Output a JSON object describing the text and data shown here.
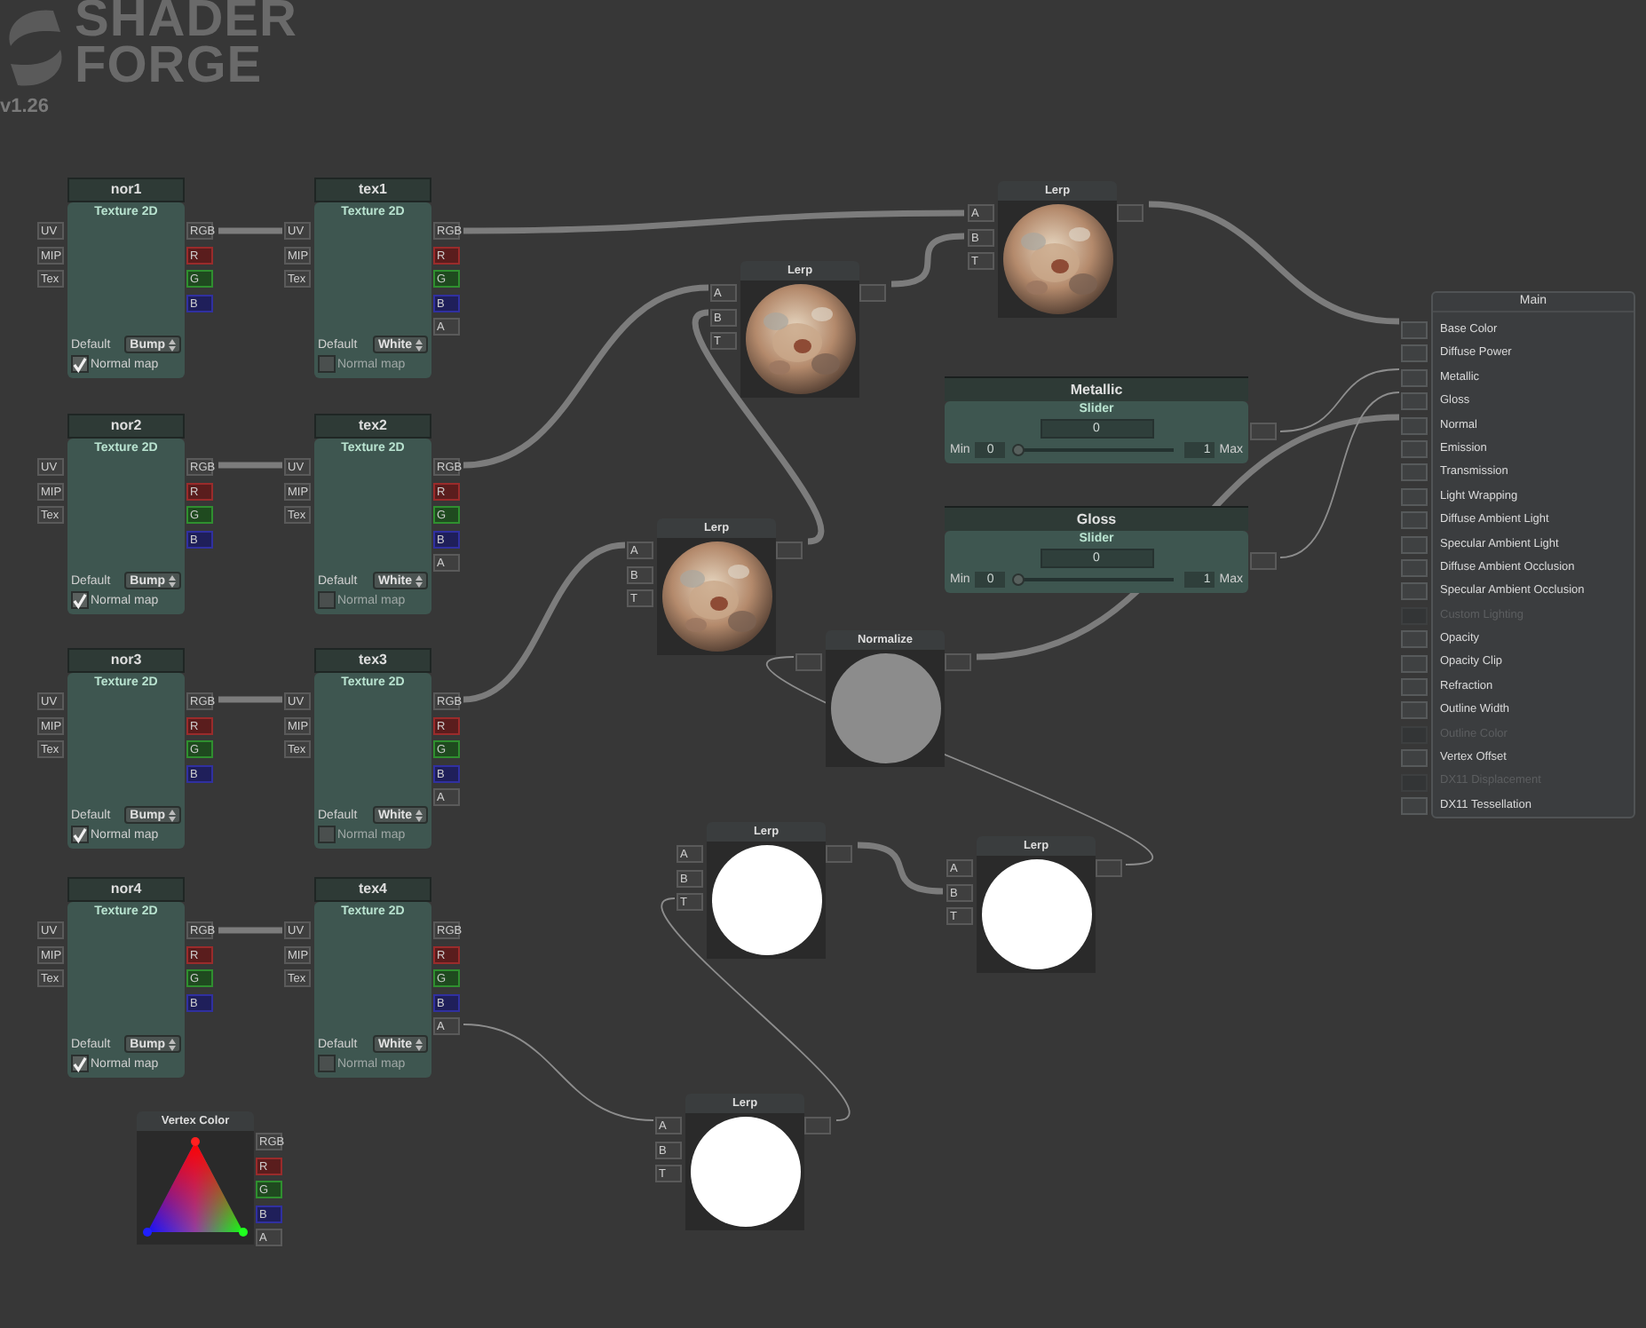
{
  "logo": {
    "line1": "SHADER",
    "line2": "FORGE",
    "version": "v1.26"
  },
  "texture_nodes": [
    {
      "title": "nor1",
      "subtitle": "Texture 2D",
      "inputs": [
        "UV",
        "MIP",
        "Tex"
      ],
      "outputs": [
        {
          "label": "RGB",
          "kind": "plain"
        },
        {
          "label": "R",
          "kind": "r"
        },
        {
          "label": "G",
          "kind": "g"
        },
        {
          "label": "B",
          "kind": "b"
        }
      ],
      "default_label": "Default",
      "default_value": "Bump",
      "normal_map_label": "Normal map",
      "normal_map": true
    },
    {
      "title": "tex1",
      "subtitle": "Texture 2D",
      "inputs": [
        "UV",
        "MIP",
        "Tex"
      ],
      "outputs": [
        {
          "label": "RGB",
          "kind": "plain"
        },
        {
          "label": "R",
          "kind": "r"
        },
        {
          "label": "G",
          "kind": "g"
        },
        {
          "label": "B",
          "kind": "b"
        },
        {
          "label": "A",
          "kind": "plain"
        }
      ],
      "default_label": "Default",
      "default_value": "White",
      "normal_map_label": "Normal map",
      "normal_map": false
    },
    {
      "title": "nor2",
      "subtitle": "Texture 2D",
      "inputs": [
        "UV",
        "MIP",
        "Tex"
      ],
      "outputs": [
        {
          "label": "RGB",
          "kind": "plain"
        },
        {
          "label": "R",
          "kind": "r"
        },
        {
          "label": "G",
          "kind": "g"
        },
        {
          "label": "B",
          "kind": "b"
        }
      ],
      "default_label": "Default",
      "default_value": "Bump",
      "normal_map_label": "Normal map",
      "normal_map": true
    },
    {
      "title": "tex2",
      "subtitle": "Texture 2D",
      "inputs": [
        "UV",
        "MIP",
        "Tex"
      ],
      "outputs": [
        {
          "label": "RGB",
          "kind": "plain"
        },
        {
          "label": "R",
          "kind": "r"
        },
        {
          "label": "G",
          "kind": "g"
        },
        {
          "label": "B",
          "kind": "b"
        },
        {
          "label": "A",
          "kind": "plain"
        }
      ],
      "default_label": "Default",
      "default_value": "White",
      "normal_map_label": "Normal map",
      "normal_map": false
    },
    {
      "title": "nor3",
      "subtitle": "Texture 2D",
      "inputs": [
        "UV",
        "MIP",
        "Tex"
      ],
      "outputs": [
        {
          "label": "RGB",
          "kind": "plain"
        },
        {
          "label": "R",
          "kind": "r"
        },
        {
          "label": "G",
          "kind": "g"
        },
        {
          "label": "B",
          "kind": "b"
        }
      ],
      "default_label": "Default",
      "default_value": "Bump",
      "normal_map_label": "Normal map",
      "normal_map": true
    },
    {
      "title": "tex3",
      "subtitle": "Texture 2D",
      "inputs": [
        "UV",
        "MIP",
        "Tex"
      ],
      "outputs": [
        {
          "label": "RGB",
          "kind": "plain"
        },
        {
          "label": "R",
          "kind": "r"
        },
        {
          "label": "G",
          "kind": "g"
        },
        {
          "label": "B",
          "kind": "b"
        },
        {
          "label": "A",
          "kind": "plain"
        }
      ],
      "default_label": "Default",
      "default_value": "White",
      "normal_map_label": "Normal map",
      "normal_map": false
    },
    {
      "title": "nor4",
      "subtitle": "Texture 2D",
      "inputs": [
        "UV",
        "MIP",
        "Tex"
      ],
      "outputs": [
        {
          "label": "RGB",
          "kind": "plain"
        },
        {
          "label": "R",
          "kind": "r"
        },
        {
          "label": "G",
          "kind": "g"
        },
        {
          "label": "B",
          "kind": "b"
        }
      ],
      "default_label": "Default",
      "default_value": "Bump",
      "normal_map_label": "Normal map",
      "normal_map": true
    },
    {
      "title": "tex4",
      "subtitle": "Texture 2D",
      "inputs": [
        "UV",
        "MIP",
        "Tex"
      ],
      "outputs": [
        {
          "label": "RGB",
          "kind": "plain"
        },
        {
          "label": "R",
          "kind": "r"
        },
        {
          "label": "G",
          "kind": "g"
        },
        {
          "label": "B",
          "kind": "b"
        },
        {
          "label": "A",
          "kind": "plain"
        }
      ],
      "default_label": "Default",
      "default_value": "White",
      "normal_map_label": "Normal map",
      "normal_map": false
    }
  ],
  "preview_nodes": [
    {
      "title": "Lerp",
      "inputs": [
        "A",
        "B",
        "T"
      ],
      "kind": "texture"
    },
    {
      "title": "Lerp",
      "inputs": [
        "A",
        "B",
        "T"
      ],
      "kind": "texture"
    },
    {
      "title": "Lerp",
      "inputs": [
        "A",
        "B",
        "T"
      ],
      "kind": "texture"
    },
    {
      "title": "Normalize",
      "kind": "grey"
    },
    {
      "title": "Lerp",
      "inputs": [
        "A",
        "B",
        "T"
      ],
      "kind": "white"
    },
    {
      "title": "Lerp",
      "inputs": [
        "A",
        "B",
        "T"
      ],
      "kind": "white"
    },
    {
      "title": "Lerp",
      "inputs": [
        "A",
        "B",
        "T"
      ],
      "kind": "white"
    }
  ],
  "slider_nodes": [
    {
      "title": "Metallic",
      "subtitle": "Slider",
      "value": "0",
      "min_label": "Min",
      "min": "0",
      "max": "1",
      "max_label": "Max",
      "level": 0
    },
    {
      "title": "Gloss",
      "subtitle": "Slider",
      "value": "0",
      "min_label": "Min",
      "min": "0",
      "max": "1",
      "max_label": "Max",
      "level": 0
    }
  ],
  "vertex_color": {
    "title": "Vertex Color",
    "outputs": [
      {
        "label": "RGB",
        "kind": "plain"
      },
      {
        "label": "R",
        "kind": "r"
      },
      {
        "label": "G",
        "kind": "g"
      },
      {
        "label": "B",
        "kind": "b"
      },
      {
        "label": "A",
        "kind": "plain"
      }
    ]
  },
  "main": {
    "title": "Main",
    "inputs": [
      {
        "label": "Base Color",
        "disabled": false
      },
      {
        "label": "Diffuse Power",
        "disabled": false
      },
      {
        "label": "Metallic",
        "disabled": false
      },
      {
        "label": "Gloss",
        "disabled": false
      },
      {
        "label": "Normal",
        "disabled": false
      },
      {
        "label": "Emission",
        "disabled": false
      },
      {
        "label": "Transmission",
        "disabled": false
      },
      {
        "label": "Light Wrapping",
        "disabled": false
      },
      {
        "label": "Diffuse Ambient Light",
        "disabled": false
      },
      {
        "label": "Specular Ambient Light",
        "disabled": false
      },
      {
        "label": "Diffuse Ambient Occlusion",
        "disabled": false
      },
      {
        "label": "Specular Ambient Occlusion",
        "disabled": false
      },
      {
        "label": "Custom Lighting",
        "disabled": true
      },
      {
        "label": "Opacity",
        "disabled": false
      },
      {
        "label": "Opacity Clip",
        "disabled": false
      },
      {
        "label": "Refraction",
        "disabled": false
      },
      {
        "label": "Outline Width",
        "disabled": false
      },
      {
        "label": "Outline Color",
        "disabled": true
      },
      {
        "label": "Vertex Offset",
        "disabled": false
      },
      {
        "label": "DX11 Displacement",
        "disabled": true
      },
      {
        "label": "DX11 Tessellation",
        "disabled": false
      }
    ]
  }
}
